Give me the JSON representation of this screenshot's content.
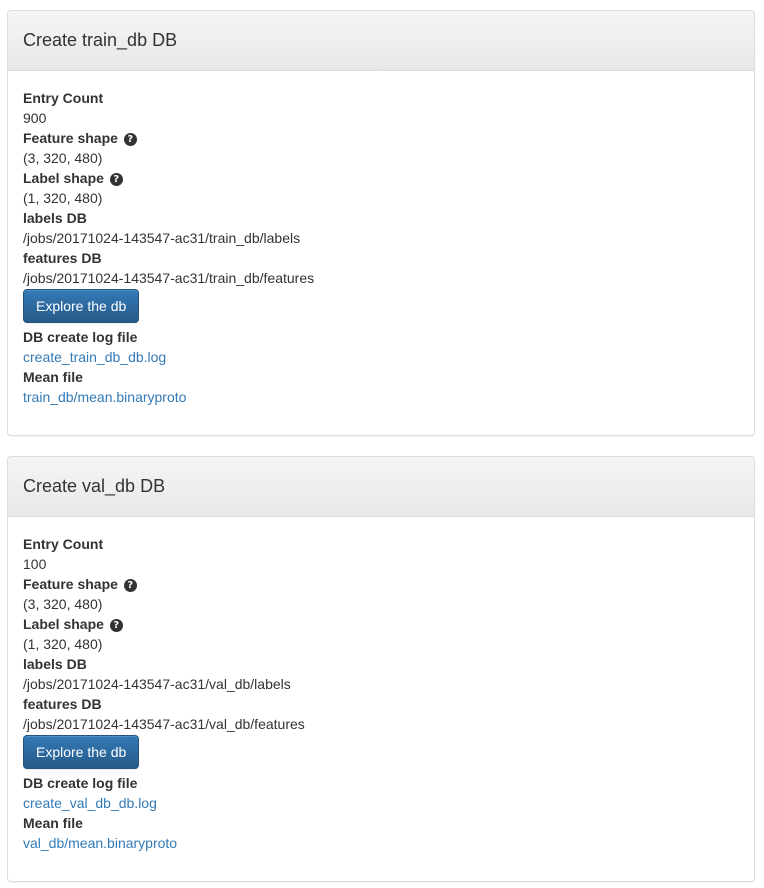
{
  "panels": [
    {
      "title": "Create train_db DB",
      "entry_count_label": "Entry Count",
      "entry_count": "900",
      "feature_shape_label": "Feature shape",
      "feature_shape": "(3, 320, 480)",
      "label_shape_label": "Label shape",
      "label_shape": "(1, 320, 480)",
      "labels_db_label": "labels DB",
      "labels_db": "/jobs/20171024-143547-ac31/train_db/labels",
      "features_db_label": "features DB",
      "features_db": "/jobs/20171024-143547-ac31/train_db/features",
      "explore_button": "Explore the db",
      "log_file_label": "DB create log file",
      "log_file": "create_train_db_db.log",
      "mean_file_label": "Mean file",
      "mean_file": "train_db/mean.binaryproto"
    },
    {
      "title": "Create val_db DB",
      "entry_count_label": "Entry Count",
      "entry_count": "100",
      "feature_shape_label": "Feature shape",
      "feature_shape": "(3, 320, 480)",
      "label_shape_label": "Label shape",
      "label_shape": "(1, 320, 480)",
      "labels_db_label": "labels DB",
      "labels_db": "/jobs/20171024-143547-ac31/val_db/labels",
      "features_db_label": "features DB",
      "features_db": "/jobs/20171024-143547-ac31/val_db/features",
      "explore_button": "Explore the db",
      "log_file_label": "DB create log file",
      "log_file": "create_val_db_db.log",
      "mean_file_label": "Mean file",
      "mean_file": "val_db/mean.binaryproto"
    }
  ],
  "icons": {
    "help": "question-circle-icon"
  },
  "colors": {
    "link": "#337ab7",
    "button": "#265a88",
    "heading_bg": "#f0f0f0"
  }
}
